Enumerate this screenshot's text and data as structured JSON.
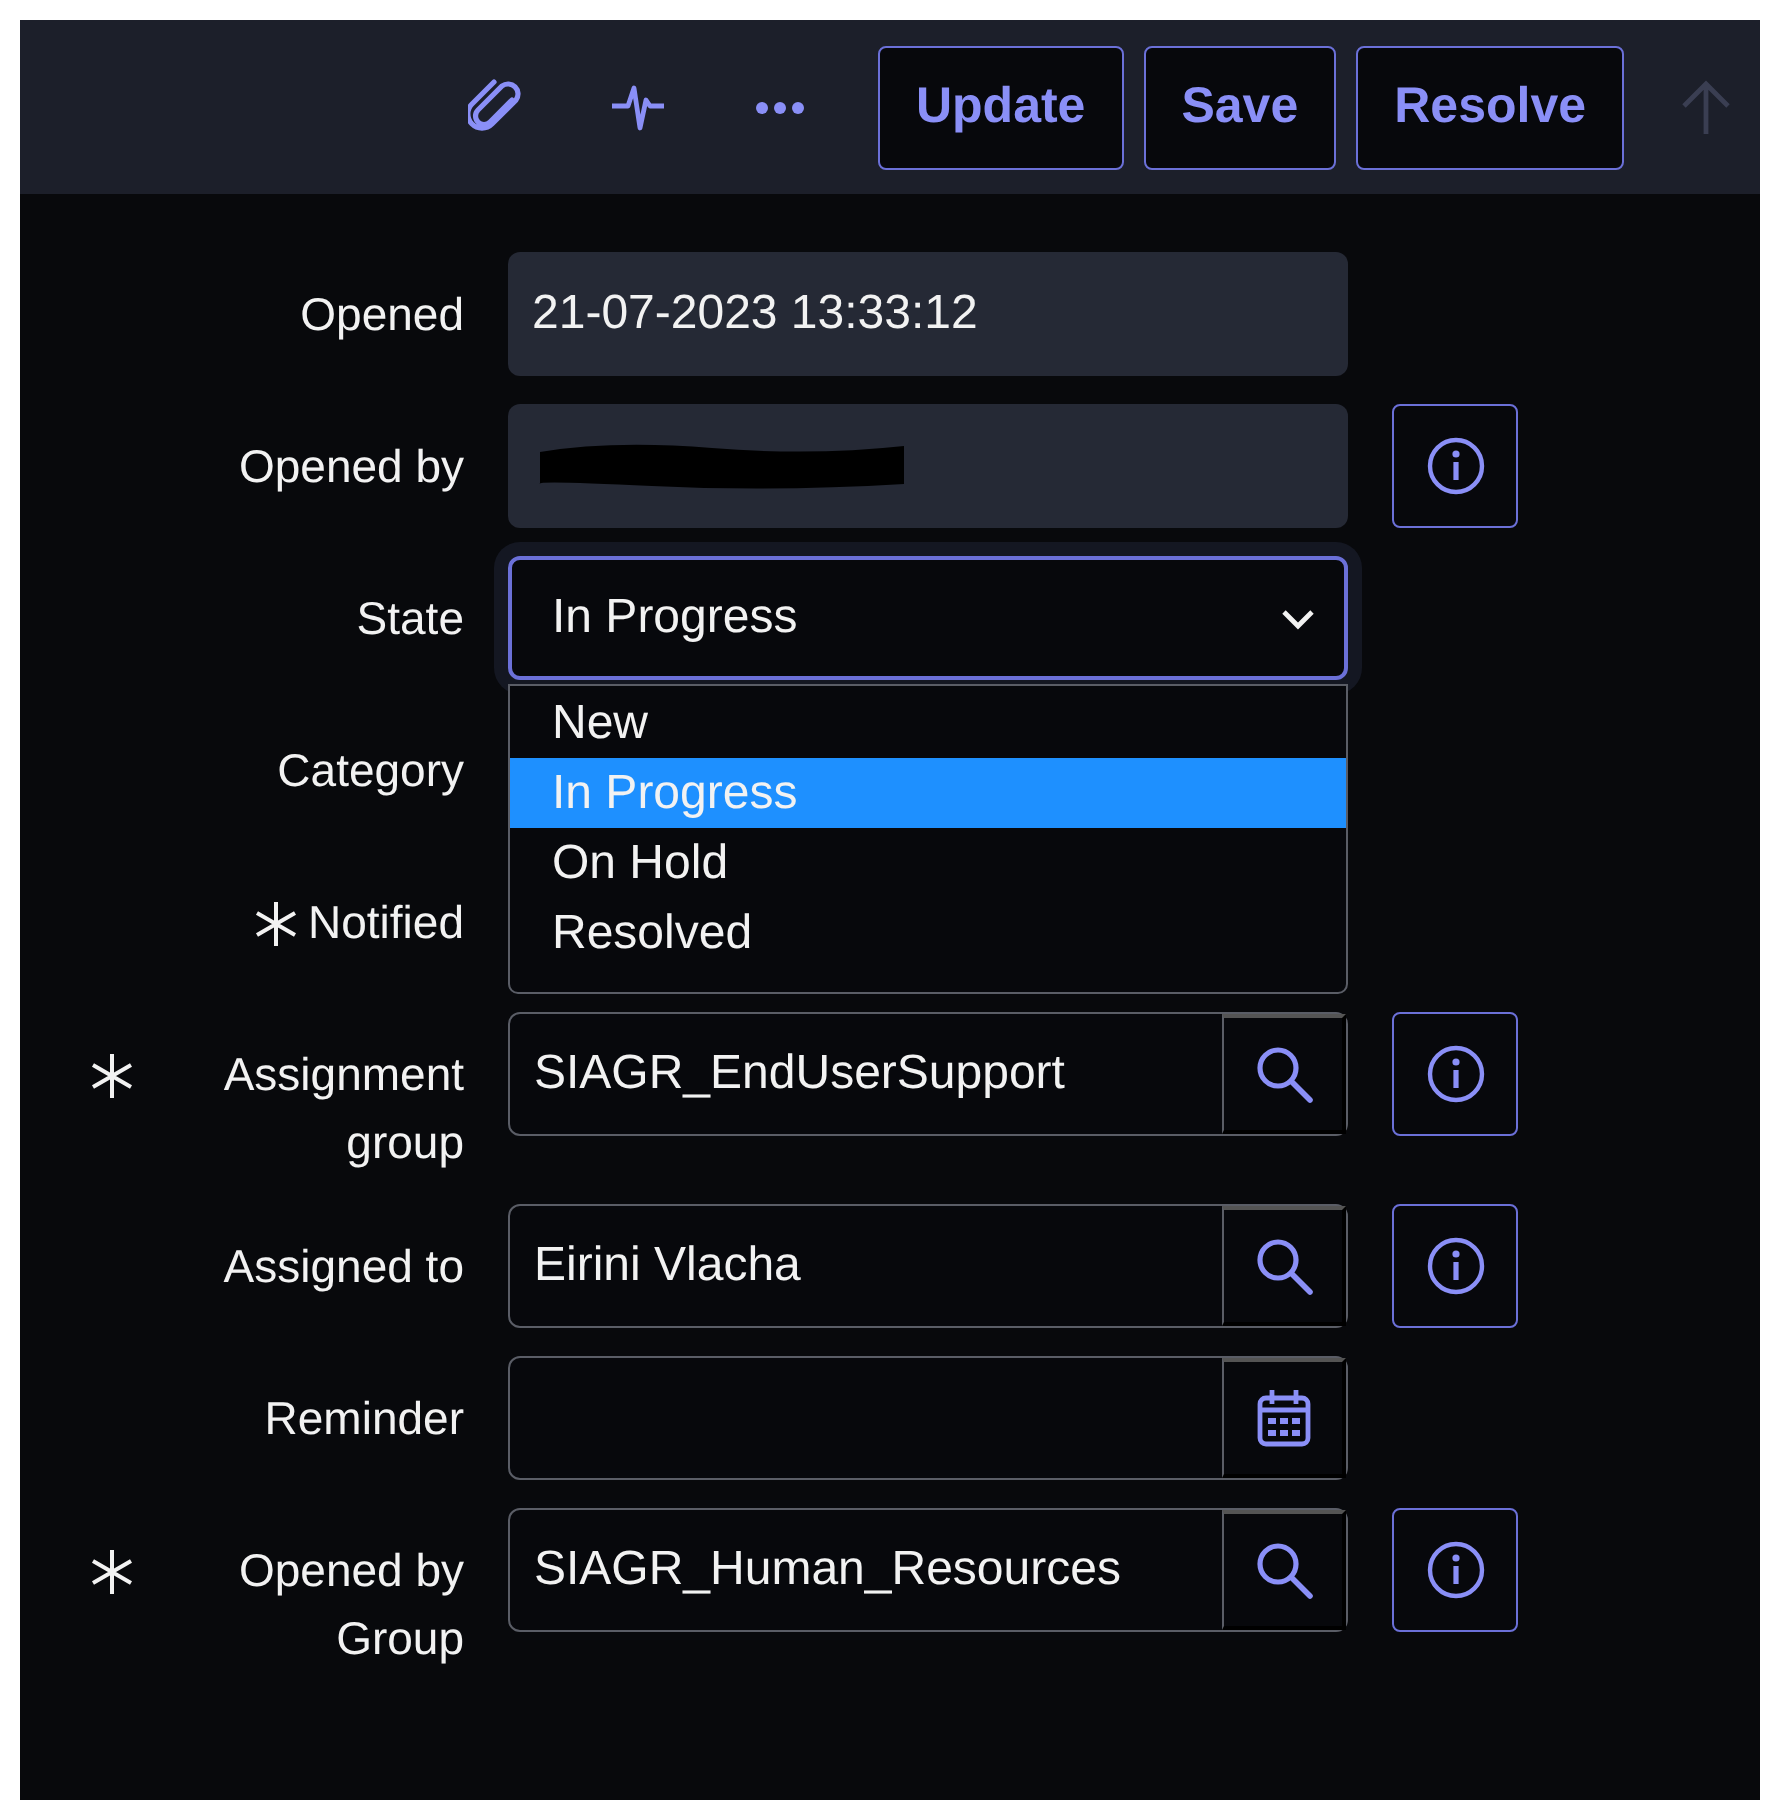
{
  "toolbar": {
    "icons": [
      {
        "kind": "attachment"
      },
      {
        "kind": "activity"
      },
      {
        "kind": "more"
      }
    ],
    "buttons": [
      "Update",
      "Save",
      "Resolve"
    ],
    "scroll_top": {
      "disabled": true
    }
  },
  "fields": [
    {
      "kind": "readonly",
      "label": "Opened",
      "value": "21-07-2023 13:33:12",
      "required": false,
      "info": false
    },
    {
      "kind": "redacted",
      "label": "Opened by",
      "required": false,
      "info": true
    },
    {
      "kind": "select",
      "label": "State",
      "value": "In Progress",
      "required": false,
      "info": false,
      "options": [
        {
          "label": "New",
          "selected": false
        },
        {
          "label": "In Progress",
          "selected": true
        },
        {
          "label": "On Hold",
          "selected": false
        },
        {
          "label": "Resolved",
          "selected": false
        }
      ]
    },
    {
      "kind": "covered",
      "label": "Category",
      "required": false,
      "info": false
    },
    {
      "kind": "covered",
      "label": "Notified",
      "required": true,
      "info": false
    },
    {
      "kind": "reference",
      "label": "Assignment group",
      "value": "SIAGR_EndUserSupport",
      "required": true,
      "info": true
    },
    {
      "kind": "reference",
      "label": "Assigned to",
      "value": "Eirini Vlacha",
      "required": false,
      "info": true
    },
    {
      "kind": "date",
      "label": "Reminder",
      "required": false,
      "info": false
    },
    {
      "kind": "reference",
      "label": "Opened by Group",
      "value": "SIAGR_Human_Resources",
      "required": true,
      "info": true
    }
  ]
}
